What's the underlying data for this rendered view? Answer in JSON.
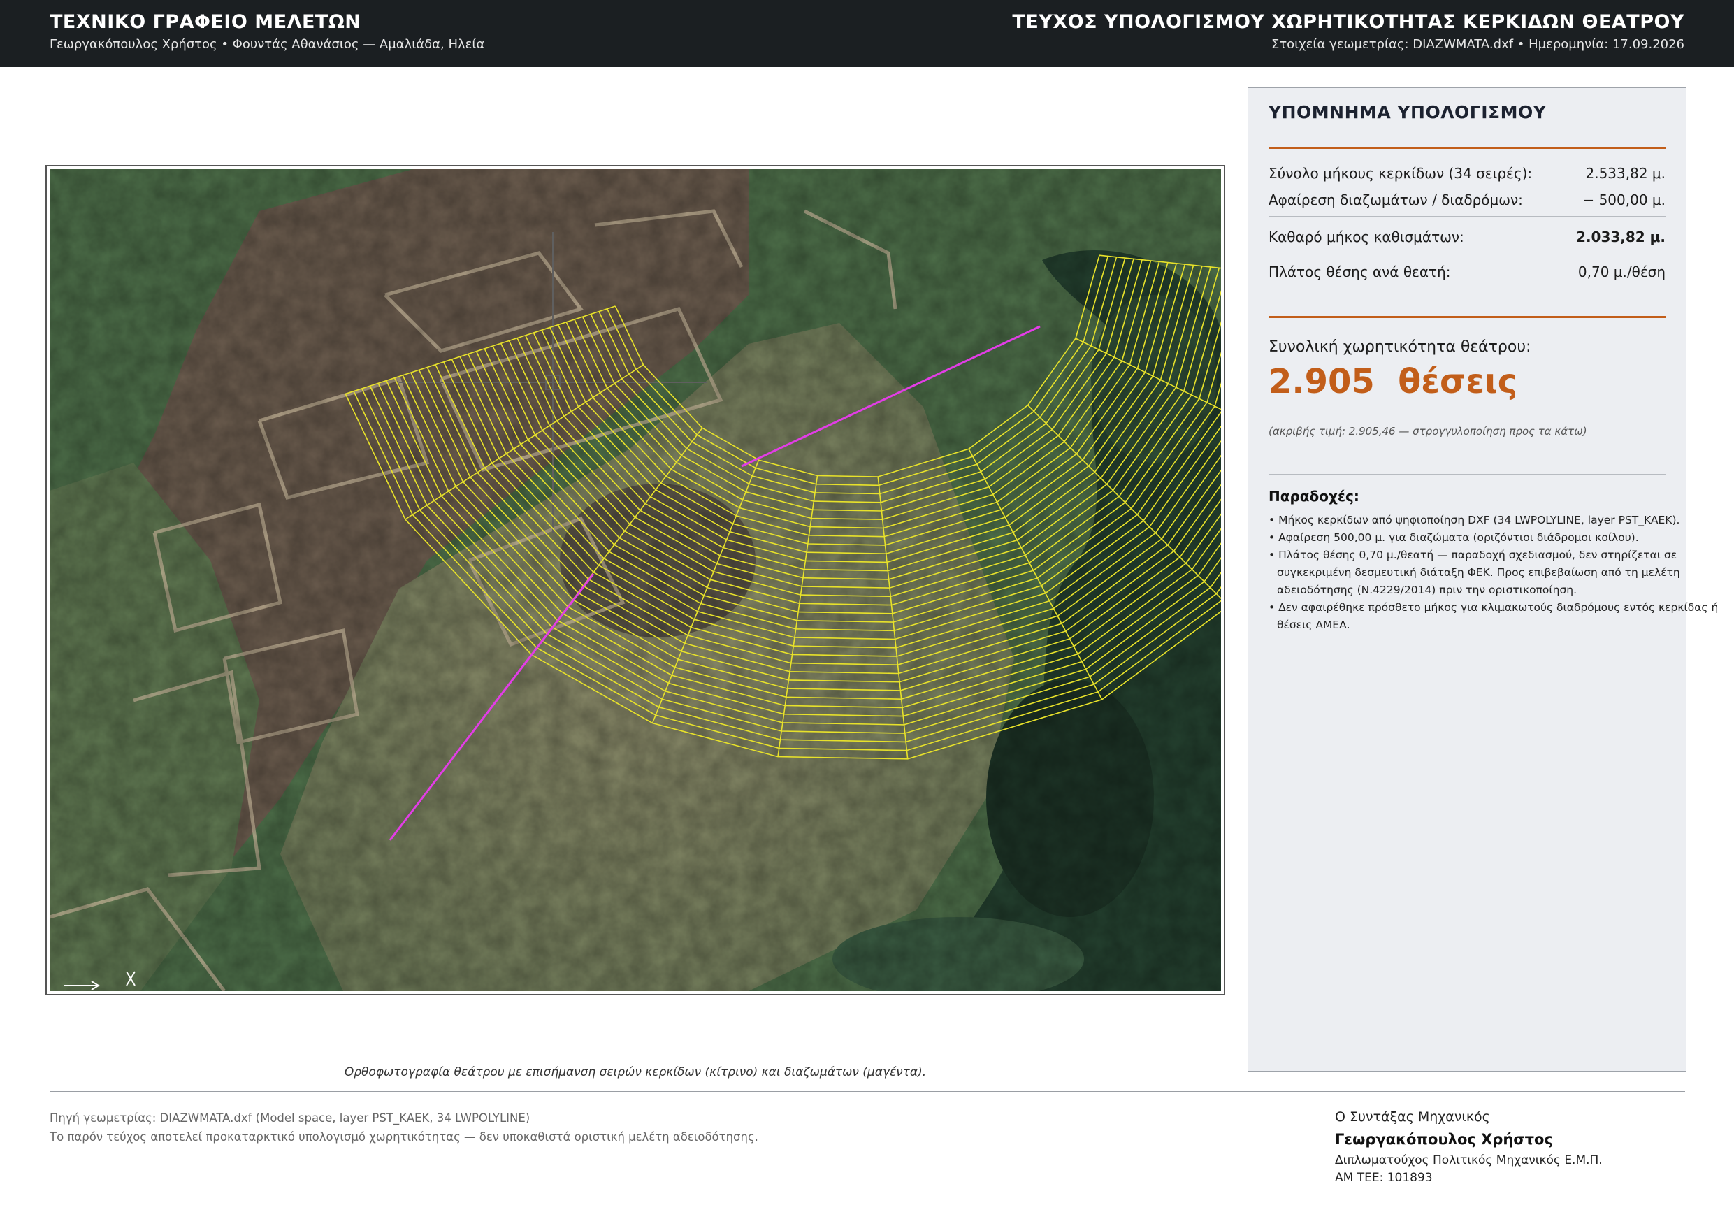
{
  "header": {
    "office": "ΤΕΧΝΙΚΟ ΓΡΑΦΕΙΟ ΜΕΛΕΤΩΝ",
    "people": "Γεωργακόπουλος Χρήστος  •  Φουντάς Αθανάσιος  —  Αμαλιάδα, Ηλεία",
    "doc_title": "ΤΕΥΧΟΣ ΥΠΟΛΟΓΙΣΜΟΥ ΧΩΡΗΤΙΚΟΤΗΤΑΣ ΚΕΡΚΙΔΩΝ ΘΕΑΤΡΟΥ",
    "doc_meta": "Στοιχεία γεωμετρίας: DIAZWMATA.dxf   •   Ημερομηνία: 17.09.2026"
  },
  "map": {
    "caption": "Ορθοφωτογραφία θεάτρου με επισήμανση σειρών κερκίδων (κίτρινο) και διαζωμάτων (μαγέντα).",
    "rows_color": "#e8e22a",
    "diazoma_color": "#e23de6"
  },
  "panel": {
    "title": "ΥΠΟΜΝΗΜΑ ΥΠΟΛΟΓΙΣΜΟΥ",
    "rows": [
      {
        "label": "Σύνολο μήκους κερκίδων (34 σειρές):",
        "value": "2.533,82 μ."
      },
      {
        "label": "Αφαίρεση διαζωμάτων / διαδρόμων:",
        "value": "− 500,00 μ."
      },
      {
        "label": "Καθαρό μήκος καθισμάτων:",
        "value": "2.033,82 μ."
      },
      {
        "label": "Πλάτος θέσης ανά θεατή:",
        "value": "0,70 μ./θέση"
      }
    ],
    "capacity_label": "Συνολική χωρητικότητα θεάτρου:",
    "capacity_value": "2.905  θέσεις",
    "capacity_note": "(ακριβής τιμή: 2.905,46 — στρογγυλοποίηση προς τα κάτω)",
    "assumptions_title": "Παραδοχές:",
    "assumptions": [
      "• Μήκος κερκίδων από ψηφιοποίηση DXF (34 LWPOLYLINE, layer PST_KAEK).",
      "• Αφαίρεση 500,00 μ. για διαζώματα (οριζόντιοι διάδρομοι κοίλου).",
      "• Πλάτος θέσης 0,70 μ./θεατή — παραδοχή σχεδιασμού, δεν στηρίζεται σε συγκεκριμένη δεσμευτική διάταξη ΦΕΚ. Προς επιβεβαίωση από τη μελέτη αδειοδότησης (Ν.4229/2014) πριν την οριστικοποίηση.",
      "• Δεν αφαιρέθηκε πρόσθετο μήκος για κλιμακωτούς διαδρόμους εντός κερκίδας ή θέσεις ΑΜΕΑ."
    ],
    "accent": "#c25e1a"
  },
  "footer": {
    "source": "Πηγή γεωμετρίας: DIAZWMATA.dxf  (Model space, layer PST_KAEK, 34 LWPOLYLINE)",
    "disclaimer": "Το παρόν τεύχος αποτελεί προκαταρκτικό υπολογισμό χωρητικότητας — δεν υποκαθιστά οριστική μελέτη αδειοδότησης.",
    "sig_role": "Ο Συντάξας Μηχανικός",
    "sig_name": "Γεωργακόπουλος Χρήστος",
    "sig_title": "Διπλωματούχος Πολιτικός Μηχανικός Ε.Μ.Π.",
    "sig_reg": "ΑΜ ΤΕΕ: 101893"
  }
}
